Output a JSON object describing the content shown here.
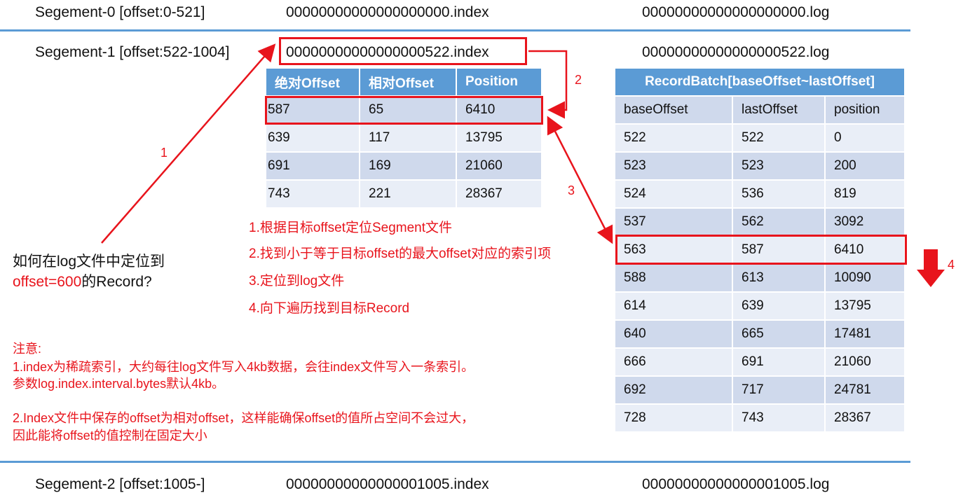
{
  "segments": [
    {
      "label": "Segement-0 [offset:0-521]",
      "index_file": "00000000000000000000.index",
      "log_file": "00000000000000000000.log"
    },
    {
      "label": "Segement-1 [offset:522-1004]",
      "index_file": "00000000000000000522.index",
      "log_file": "00000000000000000522.log"
    },
    {
      "label": "Segement-2 [offset:1005-]",
      "index_file": "00000000000000001005.index",
      "log_file": "00000000000000001005.log"
    }
  ],
  "index_table": {
    "headers": [
      "绝对Offset",
      "相对Offset",
      "Position"
    ],
    "rows": [
      [
        "587",
        "65",
        "6410"
      ],
      [
        "639",
        "117",
        "13795"
      ],
      [
        "691",
        "169",
        "21060"
      ],
      [
        "743",
        "221",
        "28367"
      ]
    ]
  },
  "log_table": {
    "title": "RecordBatch[baseOffset~lastOffset]",
    "headers": [
      "baseOffset",
      "lastOffset",
      "position"
    ],
    "rows": [
      [
        "522",
        "522",
        "0"
      ],
      [
        "523",
        "523",
        "200"
      ],
      [
        "524",
        "536",
        "819"
      ],
      [
        "537",
        "562",
        "3092"
      ],
      [
        "563",
        "587",
        "6410"
      ],
      [
        "588",
        "613",
        "10090"
      ],
      [
        "614",
        "639",
        "13795"
      ],
      [
        "640",
        "665",
        "17481"
      ],
      [
        "666",
        "691",
        "21060"
      ],
      [
        "692",
        "717",
        "24781"
      ],
      [
        "728",
        "743",
        "28367"
      ]
    ]
  },
  "question": {
    "line1": "如何在log文件中定位到",
    "line2_red": "offset=600",
    "line2_rest": "的Record?"
  },
  "steps": [
    "1.根据目标offset定位Segment文件",
    "2.找到小于等于目标offset的最大offset对应的索引项",
    "3.定位到log文件",
    "4.向下遍历找到目标Record"
  ],
  "arrow_labels": [
    "1",
    "2",
    "3",
    "4"
  ],
  "notes": {
    "title": "注意:",
    "line1": "1.index为稀疏索引，大约每往log文件写入4kb数据，会往index文件写入一条索引。",
    "line2": "参数log.index.interval.bytes默认4kb。",
    "line3": "2.Index文件中保存的offset为相对offset，这样能确保offset的值所占空间不会过大，",
    "line4": "因此能将offset的值控制在固定大小"
  },
  "colors": {
    "accent": "#5b9bd5",
    "highlight": "#e8141c"
  }
}
